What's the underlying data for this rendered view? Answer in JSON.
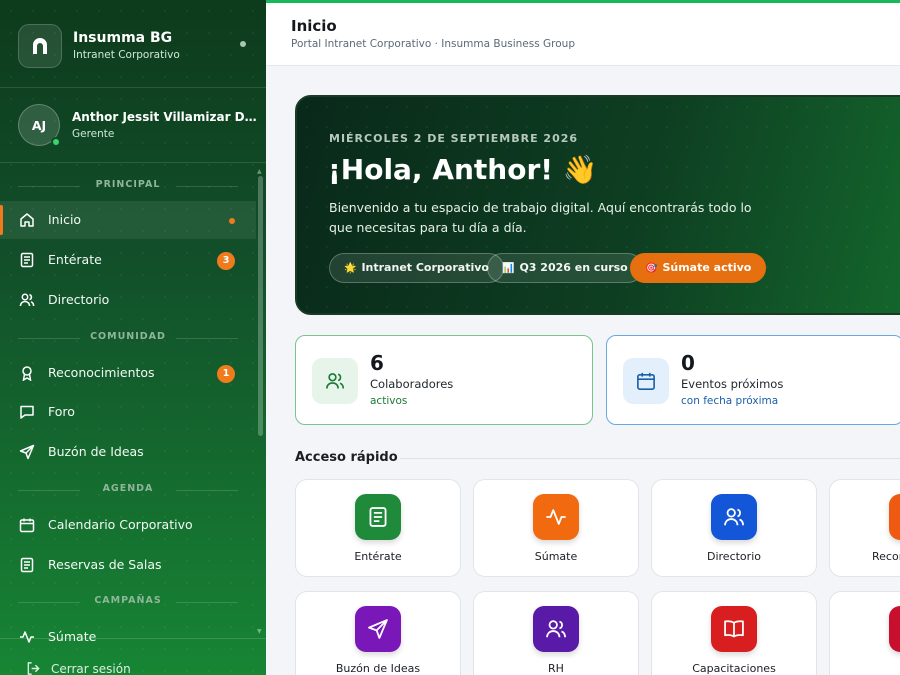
{
  "brand": {
    "name": "Insumma BG",
    "subtitle": "Intranet Corporativo"
  },
  "user": {
    "initials": "AJ",
    "name": "Anthor Jessit Villamizar Dul...",
    "role": "Gerente"
  },
  "sidebar": {
    "sections": [
      {
        "label": "PRINCIPAL"
      },
      {
        "label": "COMUNIDAD"
      },
      {
        "label": "AGENDA"
      },
      {
        "label": "CAMPAÑAS"
      }
    ],
    "items": [
      {
        "label": "Inicio",
        "icon": "home-icon"
      },
      {
        "label": "Entérate",
        "icon": "news-icon",
        "badge": "3"
      },
      {
        "label": "Directorio",
        "icon": "users-icon"
      },
      {
        "label": "Reconocimientos",
        "icon": "award-icon",
        "badge": "1"
      },
      {
        "label": "Foro",
        "icon": "chat-icon"
      },
      {
        "label": "Buzón de Ideas",
        "icon": "send-icon"
      },
      {
        "label": "Calendario Corporativo",
        "icon": "calendar-icon"
      },
      {
        "label": "Reservas de Salas",
        "icon": "room-icon"
      },
      {
        "label": "Súmate",
        "icon": "activity-icon"
      }
    ],
    "logout": "Cerrar sesión"
  },
  "header": {
    "title": "Inicio",
    "subtitle": "Portal Intranet Corporativo · Insumma Business Group"
  },
  "hero": {
    "date": "MIÉRCOLES 2 DE SEPTIEMBRE 2026",
    "greeting": "¡Hola, Anthor! 👋",
    "text": "Bienvenido a tu espacio de trabajo digital. Aquí encontrarás todo lo que necesitas para tu día a día.",
    "pills": [
      {
        "emoji": "🌟",
        "label": "Intranet Corporativo"
      },
      {
        "emoji": "📊",
        "label": "Q3 2026 en curso"
      },
      {
        "emoji": "🎯",
        "label": "Súmate activo"
      }
    ]
  },
  "stats": [
    {
      "value": "6",
      "label": "Colaboradores",
      "sub": "activos"
    },
    {
      "value": "0",
      "label": "Eventos próximos",
      "sub": "con fecha próxima"
    }
  ],
  "quick_access": {
    "title": "Acceso rápido",
    "tiles": [
      {
        "label": "Entérate",
        "color": "#1f8a3a"
      },
      {
        "label": "Súmate",
        "color": "#f26a10"
      },
      {
        "label": "Directorio",
        "color": "#1456d8"
      },
      {
        "label": "Recon",
        "color": "#ef5a12"
      },
      {
        "label": "Buzón de Ideas",
        "color": "#7a17b8"
      },
      {
        "label": "RH",
        "color": "#5a1aa8"
      },
      {
        "label": "Capacitaciones",
        "color": "#d81e1e"
      },
      {
        "label": "",
        "color": "#c8102e"
      }
    ]
  }
}
